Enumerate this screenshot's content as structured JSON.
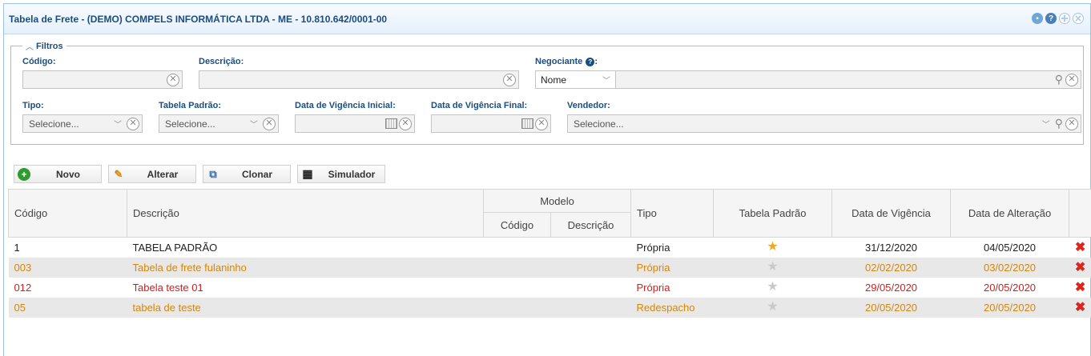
{
  "window": {
    "title": "Tabela de Frete - (DEMO) COMPELS INFORMÁTICA LTDA - ME - 10.810.642/0001-00"
  },
  "filters": {
    "legend": "Filtros",
    "codigo_label": "Código:",
    "descricao_label": "Descrição:",
    "negociante_label": "Negociante",
    "negociante_type": "Nome",
    "tipo_label": "Tipo:",
    "tipo_placeholder": "Selecione...",
    "tabela_padrao_label": "Tabela Padrão:",
    "tabela_padrao_placeholder": "Selecione...",
    "vigencia_inicial_label": "Data de Vigência Inicial:",
    "vigencia_final_label": "Data de Vigência Final:",
    "vendedor_label": "Vendedor:",
    "vendedor_placeholder": "Selecione..."
  },
  "toolbar": {
    "novo": "Novo",
    "alterar": "Alterar",
    "clonar": "Clonar",
    "simulador": "Simulador"
  },
  "table": {
    "headers": {
      "codigo": "Código",
      "descricao": "Descrição",
      "modelo": "Modelo",
      "modelo_codigo": "Código",
      "modelo_descricao": "Descrição",
      "tipo": "Tipo",
      "tabela_padrao": "Tabela Padrão",
      "data_vigencia": "Data de Vigência",
      "data_alteracao": "Data de Alteração"
    },
    "rows": [
      {
        "codigo": "1",
        "descricao": "TABELA PADRÃO",
        "modelo_codigo": "",
        "modelo_descricao": "",
        "tipo": "Própria",
        "padrao": true,
        "vigencia": "31/12/2020",
        "alteracao": "04/05/2020",
        "color": "#222222"
      },
      {
        "codigo": "003",
        "descricao": "Tabela de frete fulaninho",
        "modelo_codigo": "",
        "modelo_descricao": "",
        "tipo": "Própria",
        "padrao": false,
        "vigencia": "02/02/2020",
        "alteracao": "03/02/2020",
        "color": "#d4870b"
      },
      {
        "codigo": "012",
        "descricao": "Tabela teste 01",
        "modelo_codigo": "",
        "modelo_descricao": "",
        "tipo": "Própria",
        "padrao": false,
        "vigencia": "29/05/2020",
        "alteracao": "20/05/2020",
        "color": "#cc1f1f"
      },
      {
        "codigo": "05",
        "descricao": "tabela de teste",
        "modelo_codigo": "",
        "modelo_descricao": "",
        "tipo": "Redespacho",
        "padrao": false,
        "vigencia": "20/05/2020",
        "alteracao": "20/05/2020",
        "color": "#d4870b"
      }
    ]
  },
  "icons": {
    "title_buttons": [
      "minimize-icon",
      "help-icon",
      "maximize-icon",
      "close-icon"
    ],
    "row_action": "delete-icon",
    "padrao_on": "star-filled-icon",
    "padrao_off": "star-empty-icon"
  }
}
